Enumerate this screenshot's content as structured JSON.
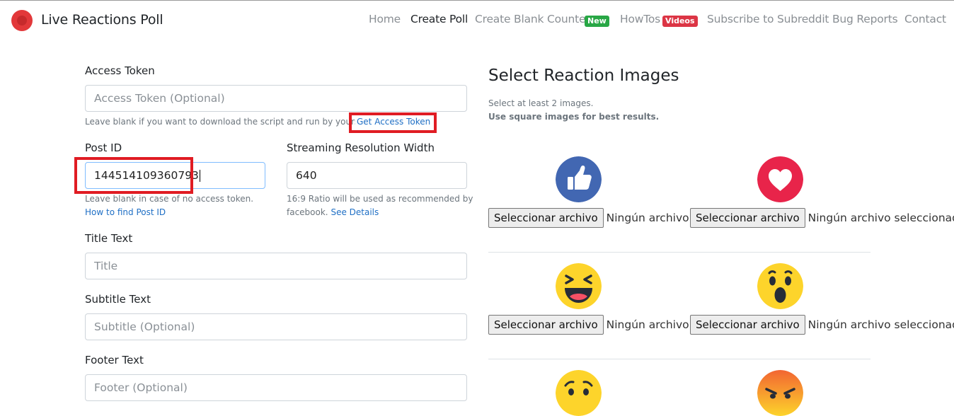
{
  "navbar": {
    "brand": "Live Reactions Poll",
    "links": [
      {
        "label": "Home"
      },
      {
        "label": "Create Poll"
      },
      {
        "label": "Create Blank Counter",
        "badge": "New"
      },
      {
        "label": "HowTos",
        "badge": "Videos"
      },
      {
        "label": "Subscribe to Subreddit"
      },
      {
        "label": "Bug Reports"
      },
      {
        "label": "Contact"
      }
    ]
  },
  "form": {
    "access_token": {
      "label": "Access Token",
      "placeholder": "Access Token (Optional)",
      "help": "Leave blank if you want to download the script and run by yourself.",
      "link": "Get Access Token"
    },
    "post_id": {
      "label": "Post ID",
      "value": "144514109360793",
      "help": "Leave blank in case of no access token.",
      "link": "How to find Post ID"
    },
    "stream_width": {
      "label": "Streaming Resolution Width",
      "value": "640",
      "help_line1": "16:9 Ratio will be used as recommended by",
      "help_line2": "facebook.",
      "link": "See Details"
    },
    "title": {
      "label": "Title Text",
      "placeholder": "Title"
    },
    "subtitle": {
      "label": "Subtitle Text",
      "placeholder": "Subtitle (Optional)"
    },
    "footer": {
      "label": "Footer Text",
      "placeholder": "Footer (Optional)"
    }
  },
  "reactions": {
    "heading": "Select Reaction Images",
    "note1": "Select at least 2 images.",
    "note2": "Use square images for best results.",
    "file_button": "Seleccionar archivo",
    "file_status": "Ningún archivo seleccionado",
    "items": [
      {
        "icon": "like-icon"
      },
      {
        "icon": "love-icon"
      },
      {
        "icon": "haha-icon"
      },
      {
        "icon": "wow-icon"
      },
      {
        "icon": "sad-icon"
      },
      {
        "icon": "angry-icon"
      }
    ]
  },
  "colors": {
    "like": "#4267b2",
    "love": "#e8244a",
    "emoji_yellow": "#fdd42b",
    "angry_orange": "#f26532",
    "highlight": "#e01c23",
    "link": "#1f6fc5"
  }
}
